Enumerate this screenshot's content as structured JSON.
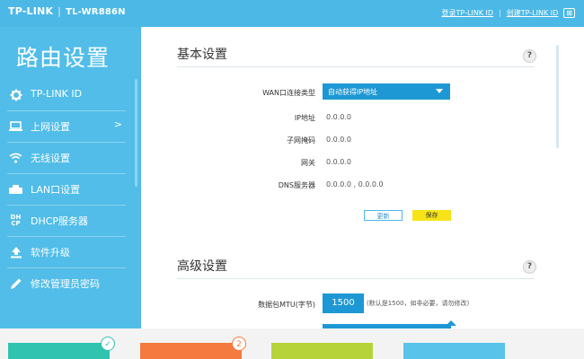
{
  "brand": {
    "logo": "TP-LINK",
    "separator": "|",
    "model": "TL-WR886N"
  },
  "top_links": {
    "login": "登录TP-LINK ID",
    "create": "创建TP-LINK ID",
    "divider": "|",
    "close_icon": "⊠"
  },
  "sidebar": {
    "title": "路由设置",
    "items": [
      {
        "label": "TP-LINK ID",
        "icon": "gear-icon"
      },
      {
        "label": "上网设置",
        "icon": "laptop-icon",
        "chevron": ">"
      },
      {
        "label": "无线设置",
        "icon": "wifi-icon"
      },
      {
        "label": "LAN口设置",
        "icon": "lan-icon"
      },
      {
        "label": "DHCP服务器",
        "icon": "dhcp-icon",
        "icon_text": "DH\nCP"
      },
      {
        "label": "软件升级",
        "icon": "upload-icon"
      },
      {
        "label": "修改管理员密码",
        "icon": "pencil-icon"
      }
    ]
  },
  "basic": {
    "title": "基本设置",
    "help": "?",
    "wan_label": "WAN口连接类型",
    "wan_value": "自动获得IP地址",
    "rows": [
      {
        "label": "IP地址",
        "value": "0.0.0.0"
      },
      {
        "label": "子网掩码",
        "value": "0.0.0.0"
      },
      {
        "label": "网关",
        "value": "0.0.0.0"
      },
      {
        "label": "DNS服务器",
        "value": "0.0.0.0 , 0.0.0.0"
      }
    ],
    "refresh_label": "更新",
    "save_label": "保存"
  },
  "advanced": {
    "title": "高级设置",
    "help": "?",
    "mtu_label": "数据包MTU(字节)",
    "mtu_value": "1500",
    "mtu_hint": "(默认是1500，如非必要，请勿修改)"
  },
  "bottom_tiles": [
    {
      "color": "#30c3b0",
      "badge": "✓",
      "badge_color": "#30c3b0"
    },
    {
      "color": "#f47a3f",
      "badge": "2",
      "badge_color": "#f47a3f"
    },
    {
      "color": "#b6d43a",
      "badge": "",
      "badge_color": ""
    },
    {
      "color": "#5ac3ea",
      "badge": "",
      "badge_color": ""
    }
  ]
}
